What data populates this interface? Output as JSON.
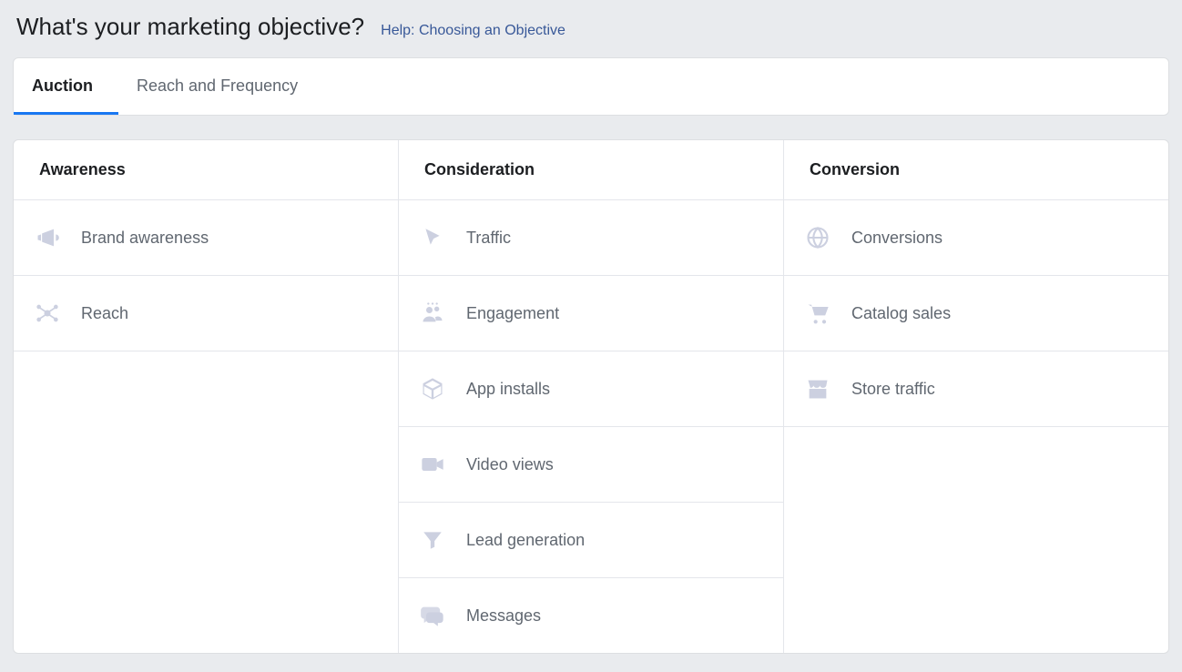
{
  "header": {
    "title": "What's your marketing objective?",
    "help_link": "Help: Choosing an Objective"
  },
  "tabs": {
    "auction": "Auction",
    "reach_frequency": "Reach and Frequency"
  },
  "columns": {
    "awareness": {
      "title": "Awareness",
      "items": {
        "brand_awareness": "Brand awareness",
        "reach": "Reach"
      }
    },
    "consideration": {
      "title": "Consideration",
      "items": {
        "traffic": "Traffic",
        "engagement": "Engagement",
        "app_installs": "App installs",
        "video_views": "Video views",
        "lead_generation": "Lead generation",
        "messages": "Messages"
      }
    },
    "conversion": {
      "title": "Conversion",
      "items": {
        "conversions": "Conversions",
        "catalog_sales": "Catalog sales",
        "store_traffic": "Store traffic"
      }
    }
  }
}
